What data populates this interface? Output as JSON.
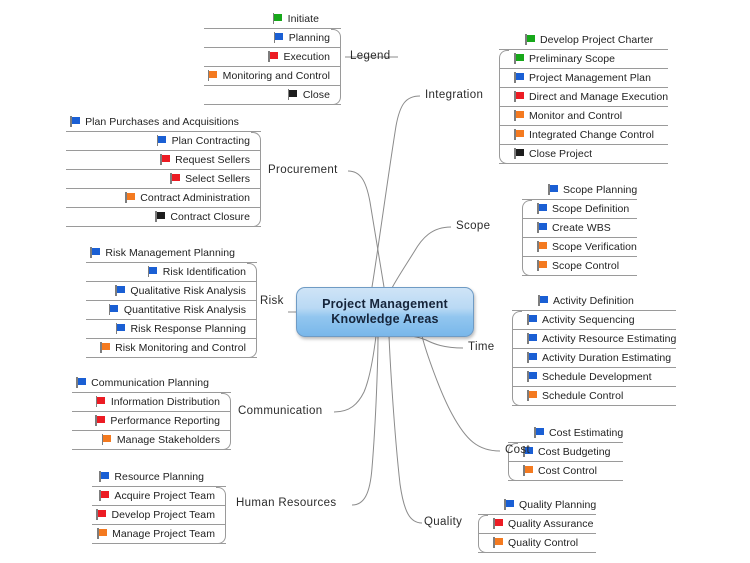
{
  "central": {
    "line1": "Project Management",
    "line2": "Knowledge Areas",
    "fill_top": "#cfe4f7",
    "fill_bottom": "#79b7ea",
    "border": "#6f9bc4"
  },
  "flag_colors": {
    "green": "#17a81a",
    "blue": "#1a5fd4",
    "red": "#ec1c24",
    "orange": "#f47a20",
    "black": "#1d1d1d"
  },
  "legend": {
    "label": "Legend",
    "items": [
      {
        "label": "Initiate",
        "flag": "green"
      },
      {
        "label": "Planning",
        "flag": "blue"
      },
      {
        "label": "Execution",
        "flag": "red"
      },
      {
        "label": "Monitoring and Control",
        "flag": "orange"
      },
      {
        "label": "Close",
        "flag": "black"
      }
    ]
  },
  "branches": [
    {
      "label": "Integration",
      "side": "right",
      "items": [
        {
          "label": "Develop Project Charter",
          "flag": "green"
        },
        {
          "label": "Preliminary Scope",
          "flag": "green"
        },
        {
          "label": "Project Management Plan",
          "flag": "blue"
        },
        {
          "label": "Direct and Manage Execution",
          "flag": "red"
        },
        {
          "label": "Monitor and Control",
          "flag": "orange"
        },
        {
          "label": "Integrated Change Control",
          "flag": "orange"
        },
        {
          "label": "Close Project",
          "flag": "black"
        }
      ]
    },
    {
      "label": "Scope",
      "side": "right",
      "items": [
        {
          "label": "Scope Planning",
          "flag": "blue"
        },
        {
          "label": "Scope Definition",
          "flag": "blue"
        },
        {
          "label": "Create WBS",
          "flag": "blue"
        },
        {
          "label": "Scope Verification",
          "flag": "orange"
        },
        {
          "label": "Scope Control",
          "flag": "orange"
        }
      ]
    },
    {
      "label": "Time",
      "side": "right",
      "items": [
        {
          "label": "Activity Definition",
          "flag": "blue"
        },
        {
          "label": "Activity Sequencing",
          "flag": "blue"
        },
        {
          "label": "Activity Resource Estimating",
          "flag": "blue"
        },
        {
          "label": "Activity Duration Estimating",
          "flag": "blue"
        },
        {
          "label": "Schedule Development",
          "flag": "blue"
        },
        {
          "label": "Schedule Control",
          "flag": "orange"
        }
      ]
    },
    {
      "label": "Cost",
      "side": "right",
      "items": [
        {
          "label": "Cost Estimating",
          "flag": "blue"
        },
        {
          "label": "Cost Budgeting",
          "flag": "blue"
        },
        {
          "label": "Cost Control",
          "flag": "orange"
        }
      ]
    },
    {
      "label": "Quality",
      "side": "right",
      "items": [
        {
          "label": "Quality Planning",
          "flag": "blue"
        },
        {
          "label": "Quality Assurance",
          "flag": "red"
        },
        {
          "label": "Quality Control",
          "flag": "orange"
        }
      ]
    },
    {
      "label": "Procurement",
      "side": "left",
      "items": [
        {
          "label": "Plan Purchases and Acquisitions",
          "flag": "blue"
        },
        {
          "label": "Plan Contracting",
          "flag": "blue"
        },
        {
          "label": "Request Sellers",
          "flag": "red"
        },
        {
          "label": "Select Sellers",
          "flag": "red"
        },
        {
          "label": "Contract Administration",
          "flag": "orange"
        },
        {
          "label": "Contract Closure",
          "flag": "black"
        }
      ]
    },
    {
      "label": "Risk",
      "side": "left",
      "items": [
        {
          "label": "Risk Management Planning",
          "flag": "blue"
        },
        {
          "label": "Risk Identification",
          "flag": "blue"
        },
        {
          "label": "Qualitative Risk Analysis",
          "flag": "blue"
        },
        {
          "label": "Quantitative Risk Analysis",
          "flag": "blue"
        },
        {
          "label": "Risk Response Planning",
          "flag": "blue"
        },
        {
          "label": "Risk Monitoring and Control",
          "flag": "orange"
        }
      ]
    },
    {
      "label": "Communication",
      "side": "left",
      "items": [
        {
          "label": "Communication Planning",
          "flag": "blue"
        },
        {
          "label": "Information Distribution",
          "flag": "red"
        },
        {
          "label": "Performance Reporting",
          "flag": "red"
        },
        {
          "label": "Manage Stakeholders",
          "flag": "orange"
        }
      ]
    },
    {
      "label": "Human Resources",
      "side": "left",
      "items": [
        {
          "label": "Resource Planning",
          "flag": "blue"
        },
        {
          "label": "Acquire Project Team",
          "flag": "red"
        },
        {
          "label": "Develop Project Team",
          "flag": "red"
        },
        {
          "label": "Manage Project Team",
          "flag": "orange"
        }
      ]
    }
  ]
}
